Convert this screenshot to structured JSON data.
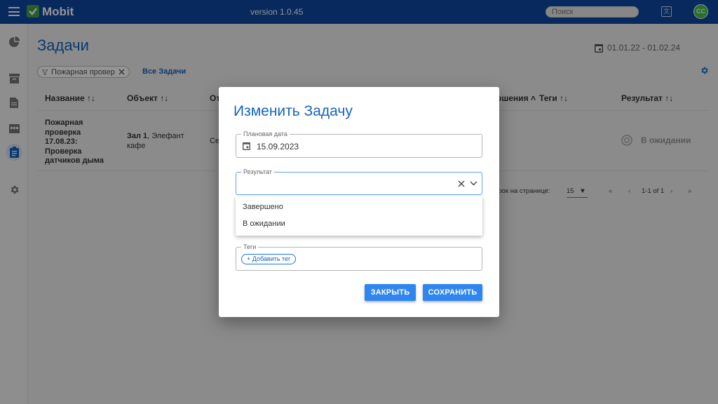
{
  "app": {
    "brand": "Mobit",
    "version": "version 1.0.45",
    "search_placeholder": "Поиск",
    "avatar_initials": "CC"
  },
  "colors": {
    "topbar": "#0d47a1",
    "accent": "#1565c0",
    "button": "#2f86f0",
    "logo": "#43a047"
  },
  "page": {
    "title": "Задачи",
    "date_range": "01.01.22 - 01.02.24",
    "filter_chip": "Пожарная провер",
    "all_tasks_link": "Все Задачи"
  },
  "table": {
    "headers": {
      "name": "Название ↑↓",
      "object": "Объект ↑↓",
      "col3": "От",
      "col_date": "ршения ˄",
      "tags": "Теги ↑↓",
      "result": "Результат ↑↓"
    },
    "row": {
      "name_lines": [
        "Пожарная",
        "проверка",
        "17.08.23:",
        "Проверка",
        "датчиков дыма"
      ],
      "object_bold": "Зал 1",
      "object_rest": ", Элефант",
      "object_line2": "кафе",
      "col3": "Се",
      "result": "В ожидании"
    },
    "pagination": {
      "rows_label": "трок на странице:",
      "rows_value": "15",
      "range": "1-1 of 1"
    }
  },
  "dialog": {
    "title": "Изменить Задачу",
    "planned_date_label": "Плановая дата",
    "planned_date_value": "15.09.2023",
    "result_label": "Результат",
    "result_options": [
      "Завершено",
      "В ожидании"
    ],
    "tags_label": "Теги",
    "add_tag": "+ Добавить тег",
    "close_button": "ЗАКРЫТЬ",
    "save_button": "СОХРАНИТЬ"
  }
}
